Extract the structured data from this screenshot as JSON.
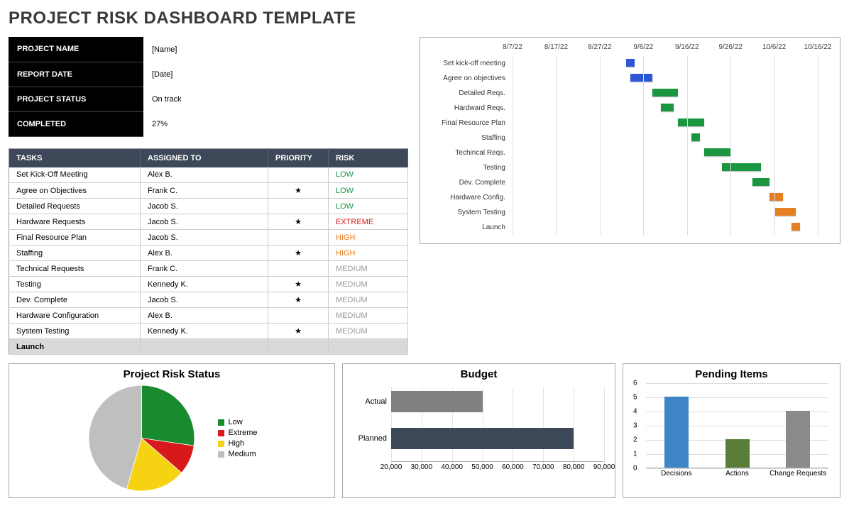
{
  "title": "PROJECT RISK DASHBOARD TEMPLATE",
  "info": {
    "rows": [
      {
        "label": "PROJECT NAME",
        "value": "[Name]"
      },
      {
        "label": "REPORT DATE",
        "value": "[Date]"
      },
      {
        "label": "PROJECT STATUS",
        "value": "On track"
      },
      {
        "label": "COMPLETED",
        "value": "27%"
      }
    ]
  },
  "tasks": {
    "headers": {
      "tasks": "TASKS",
      "assigned": "ASSIGNED TO",
      "priority": "PRIORITY",
      "risk": "RISK"
    },
    "rows": [
      {
        "task": "Set Kick-Off Meeting",
        "assigned": "Alex B.",
        "priority": "",
        "risk": "LOW"
      },
      {
        "task": "Agree on Objectives",
        "assigned": "Frank C.",
        "priority": "★",
        "risk": "LOW"
      },
      {
        "task": "Detailed Requests",
        "assigned": "Jacob S.",
        "priority": "",
        "risk": "LOW"
      },
      {
        "task": "Hardware Requests",
        "assigned": "Jacob S.",
        "priority": "★",
        "risk": "EXTREME"
      },
      {
        "task": "Final Resource Plan",
        "assigned": "Jacob S.",
        "priority": "",
        "risk": "HIGH"
      },
      {
        "task": "Staffing",
        "assigned": "Alex B.",
        "priority": "★",
        "risk": "HIGH"
      },
      {
        "task": "Technical Requests",
        "assigned": "Frank C.",
        "priority": "",
        "risk": "MEDIUM"
      },
      {
        "task": "Testing",
        "assigned": "Kennedy K.",
        "priority": "★",
        "risk": "MEDIUM"
      },
      {
        "task": "Dev. Complete",
        "assigned": "Jacob S.",
        "priority": "★",
        "risk": "MEDIUM"
      },
      {
        "task": "Hardware Configuration",
        "assigned": "Alex B.",
        "priority": "",
        "risk": "MEDIUM"
      },
      {
        "task": "System Testing",
        "assigned": "Kennedy K.",
        "priority": "★",
        "risk": "MEDIUM"
      },
      {
        "task": "Launch",
        "assigned": "",
        "priority": "",
        "risk": ""
      }
    ]
  },
  "gantt": {
    "dates": [
      "8/7/22",
      "8/17/22",
      "8/27/22",
      "9/6/22",
      "9/16/22",
      "9/26/22",
      "10/6/22",
      "10/16/22"
    ],
    "x_end": "10/16/22",
    "tasks": [
      {
        "label": "Set kick-off meeting",
        "start": "9/2/22",
        "end": "9/4/22",
        "color": "#2b57d6"
      },
      {
        "label": "Agree on objectives",
        "start": "9/3/22",
        "end": "9/8/22",
        "color": "#2b57d6"
      },
      {
        "label": "Detailed Reqs.",
        "start": "9/8/22",
        "end": "9/14/22",
        "color": "#1a9641"
      },
      {
        "label": "Hardward Reqs.",
        "start": "9/10/22",
        "end": "9/13/22",
        "color": "#1a9641"
      },
      {
        "label": "Final Resource Plan",
        "start": "9/14/22",
        "end": "9/20/22",
        "color": "#1a9641"
      },
      {
        "label": "Staffing",
        "start": "9/17/22",
        "end": "9/19/22",
        "color": "#1a9641"
      },
      {
        "label": "Techincal Reqs.",
        "start": "9/20/22",
        "end": "9/26/22",
        "color": "#1a9641"
      },
      {
        "label": "Testing",
        "start": "9/24/22",
        "end": "10/3/22",
        "color": "#1a9641"
      },
      {
        "label": "Dev. Complete",
        "start": "10/1/22",
        "end": "10/5/22",
        "color": "#1a9641"
      },
      {
        "label": "Hardware Config.",
        "start": "10/5/22",
        "end": "10/8/22",
        "color": "#e67e22"
      },
      {
        "label": "System Testing",
        "start": "10/6/22",
        "end": "10/11/22",
        "color": "#e67e22"
      },
      {
        "label": "Launch",
        "start": "10/10/22",
        "end": "10/12/22",
        "color": "#e67e22"
      }
    ]
  },
  "chart_data": [
    {
      "type": "pie",
      "title": "Project Risk Status",
      "series": [
        {
          "name": "Low",
          "value": 3,
          "color": "#1a8a2f"
        },
        {
          "name": "Extreme",
          "value": 1,
          "color": "#d7191c"
        },
        {
          "name": "High",
          "value": 2,
          "color": "#f5d313"
        },
        {
          "name": "Medium",
          "value": 5,
          "color": "#bfbfbf"
        }
      ]
    },
    {
      "type": "bar",
      "orientation": "horizontal",
      "title": "Budget",
      "categories": [
        "Actual",
        "Planned"
      ],
      "values": [
        50000,
        80000
      ],
      "colors": [
        "#808080",
        "#3d4859"
      ],
      "xlim": [
        20000,
        90000
      ],
      "xticks": [
        20000,
        30000,
        40000,
        50000,
        60000,
        70000,
        80000,
        90000
      ],
      "xtick_labels": [
        "20,000",
        "30,000",
        "40,000",
        "50,000",
        "60,000",
        "70,000",
        "80,000",
        "90,000"
      ]
    },
    {
      "type": "bar",
      "title": "Pending Items",
      "categories": [
        "Decisions",
        "Actions",
        "Change Requests"
      ],
      "values": [
        5,
        2,
        4
      ],
      "colors": [
        "#3f86c6",
        "#5a7d3a",
        "#8a8a8a"
      ],
      "ylim": [
        0,
        6
      ],
      "yticks": [
        0,
        1,
        2,
        3,
        4,
        5,
        6
      ]
    }
  ]
}
